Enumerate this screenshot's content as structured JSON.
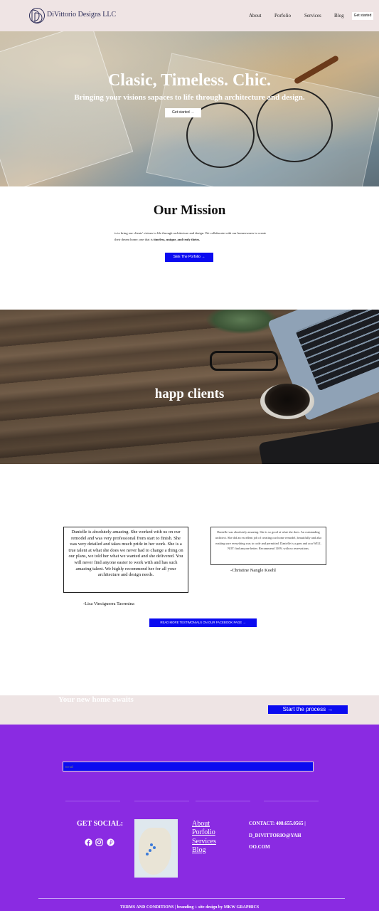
{
  "header": {
    "brand": "DiVittorio Designs LLC",
    "logo_icon": "dd-monogram-logo",
    "nav": [
      "About",
      "Porfolio",
      "Services",
      "Blog"
    ],
    "cta_label": "Get started"
  },
  "hero": {
    "title": "Clasic, Timeless. Chic.",
    "subtitle": "Bringing your visions sapaces to life through architecture and design.",
    "button_label": "Get started →"
  },
  "mission": {
    "title": "Our Mission",
    "text_part1": "is to bring our clients' visions to life through architecture and design. We collaborate with our homeowners to create their dream home; one that is ",
    "text_bold": "timeless, unique, and truly theirs.",
    "button_label": "SEE The Porfolio →"
  },
  "clients": {
    "title": "happ clients"
  },
  "testimonials": [
    {
      "text": "Danielle is absolutely amazing. She worked with us on our remodel and was very professional from start to finish. She was very detailed and takes much pride in her work. She is a true talent at what she does we never had to change a thing on our plans, we told her what we wanted and she delivered. You will never find anyone easier to work with and has such amazing talent. We highly recommend her for all your architecture and design needs.",
      "author": "-Lisa Vinciguerra Taormina"
    },
    {
      "text": "Danielle was absolutely amazing. She is so good at what she does. An outstanding architect. She did an excellent job of creating our home remodel, beautifully and also making sure everything was to code and permitted. Danielle is a gem and you WILL NOT find anyone better. Recommend 110% with no reservations.",
      "author": "-Christine Nangle Koehl"
    }
  ],
  "reviews_button_label": "READ MORE TESTIMONIALS ON OUR FACEBOOK PAGE →",
  "cta": {
    "text": "Your new home awaits",
    "button_label": "Start the process →"
  },
  "footer": {
    "input_placeholder": "Email",
    "social_title": "GET SOCIAL:",
    "social_icons": [
      "facebook-icon",
      "instagram-icon",
      "pinterest-icon"
    ],
    "links": [
      "About",
      "Porfolio",
      "Services",
      "Blog"
    ],
    "contact_lines": [
      "CONTACT: 408.655.0565 |",
      "D_DIVITTORIO@YAH",
      "OO.COM"
    ],
    "bottom_text": "TERMS AND CONDITIONS | branding + site design by MKW GRAPHICS"
  },
  "colors": {
    "header_bg": "#efe4e4",
    "accent_blue": "#0b0bf0",
    "footer_purple": "#8a2be2"
  }
}
